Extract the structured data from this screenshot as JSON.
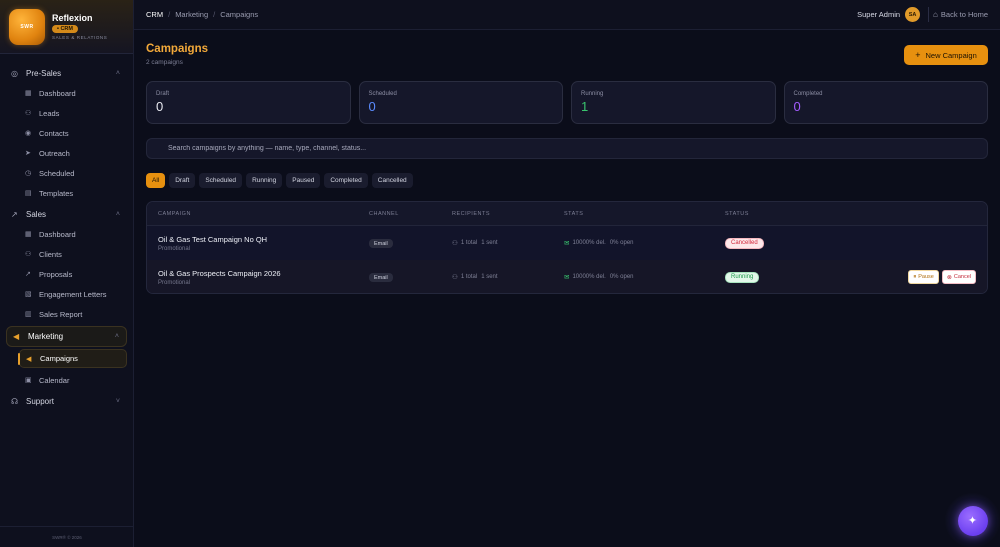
{
  "brand": {
    "logo_text": "SWR",
    "name": "Reflexion",
    "badge": "• CRM",
    "subtitle": "SALES & RELATIONS"
  },
  "sidebar": {
    "groups": [
      {
        "label": "Pre-Sales",
        "icon": "user-circle-icon",
        "items": [
          {
            "label": "Dashboard",
            "icon": "dashboard-icon"
          },
          {
            "label": "Leads",
            "icon": "users-icon"
          },
          {
            "label": "Contacts",
            "icon": "contacts-icon"
          },
          {
            "label": "Outreach",
            "icon": "send-icon"
          },
          {
            "label": "Scheduled",
            "icon": "clock-icon"
          },
          {
            "label": "Templates",
            "icon": "file-icon"
          }
        ]
      },
      {
        "label": "Sales",
        "icon": "trending-up-icon",
        "items": [
          {
            "label": "Dashboard",
            "icon": "dashboard-icon"
          },
          {
            "label": "Clients",
            "icon": "users-icon"
          },
          {
            "label": "Proposals",
            "icon": "trending-icon"
          },
          {
            "label": "Engagement Letters",
            "icon": "document-icon"
          },
          {
            "label": "Sales Report",
            "icon": "bar-chart-icon"
          }
        ]
      },
      {
        "label": "Marketing",
        "icon": "megaphone-icon",
        "items": [
          {
            "label": "Campaigns",
            "icon": "megaphone-icon"
          },
          {
            "label": "Calendar",
            "icon": "calendar-icon"
          }
        ]
      },
      {
        "label": "Support",
        "icon": "headset-icon",
        "items": []
      }
    ],
    "footer": "SWR® © 2026"
  },
  "topbar": {
    "breadcrumb": [
      "CRM",
      "Marketing",
      "Campaigns"
    ],
    "user_name": "Super Admin",
    "avatar_initials": "SA",
    "back_home": "Back to Home"
  },
  "page": {
    "title": "Campaigns",
    "subtitle": "2 campaigns",
    "new_button": "New Campaign"
  },
  "stats": [
    {
      "label": "Draft",
      "value": "0",
      "color": "#e8e9f0"
    },
    {
      "label": "Scheduled",
      "value": "0",
      "color": "#5b8cff"
    },
    {
      "label": "Running",
      "value": "1",
      "color": "#39c46e"
    },
    {
      "label": "Completed",
      "value": "0",
      "color": "#a35cff"
    }
  ],
  "search": {
    "placeholder": "Search campaigns by anything — name, type, channel, status..."
  },
  "filters": [
    "All",
    "Draft",
    "Scheduled",
    "Running",
    "Paused",
    "Completed",
    "Cancelled"
  ],
  "table": {
    "columns": [
      "CAMPAIGN",
      "CHANNEL",
      "RECIPIENTS",
      "STATS",
      "STATUS"
    ],
    "rows": [
      {
        "name": "Oil & Gas Test Campaign No QH",
        "type": "Promotional",
        "channel": "Email",
        "recipients_total": "1 total",
        "recipients_sent": "1 sent",
        "delivered": "10000% del.",
        "opened": "0% open",
        "status": "Cancelled",
        "actions": []
      },
      {
        "name": "Oil & Gas Prospects Campaign 2026",
        "type": "Promotional",
        "channel": "Email",
        "recipients_total": "1 total",
        "recipients_sent": "1 sent",
        "delivered": "10000% del.",
        "opened": "0% open",
        "status": "Running",
        "actions": [
          "Pause",
          "Cancel"
        ]
      }
    ]
  },
  "fab": {
    "icon": "sparkles-icon"
  }
}
